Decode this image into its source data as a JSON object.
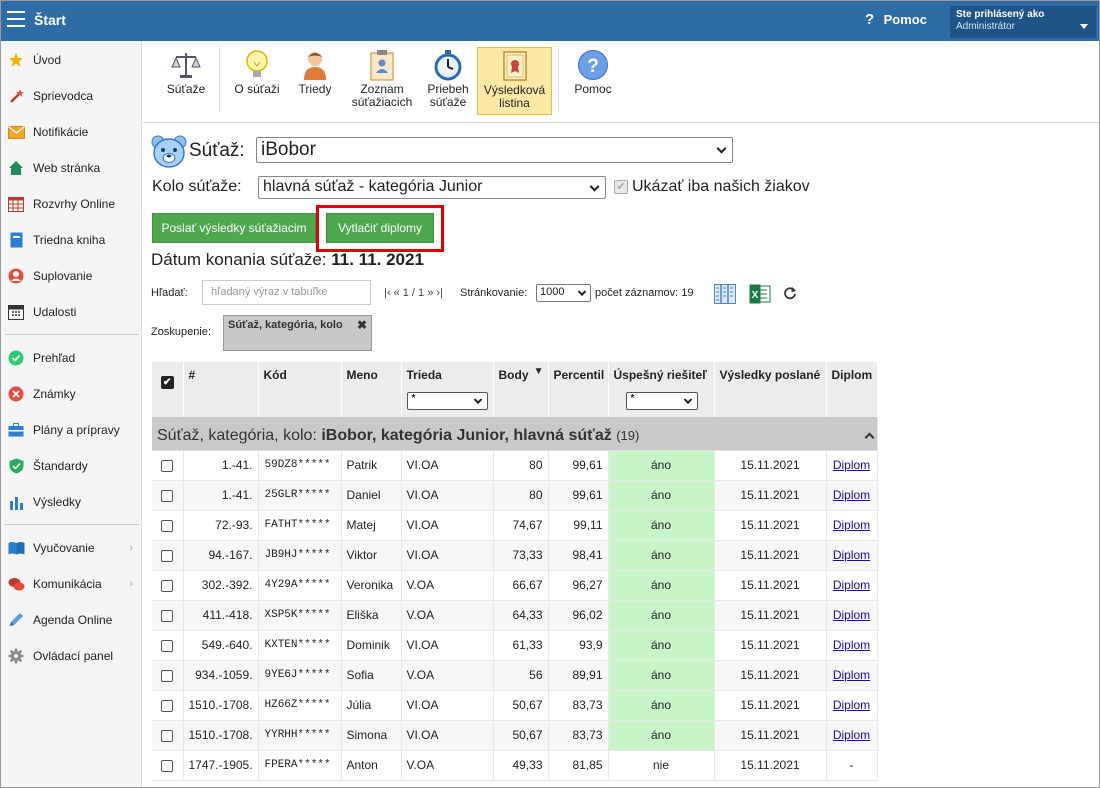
{
  "topbar": {
    "title": "Štart",
    "help": "Pomoc",
    "user_line1": "Ste prihlásený ako",
    "user_line2": "Administrátor"
  },
  "sidebar": {
    "items": [
      {
        "label": "Úvod",
        "icon": "star-icon"
      },
      {
        "label": "Sprievodca",
        "icon": "magic-wand-icon"
      },
      {
        "label": "Notifikácie",
        "icon": "envelope-icon"
      },
      {
        "label": "Web stránka",
        "icon": "home-icon"
      },
      {
        "label": "Rozvrhy Online",
        "icon": "calendar-grid-icon"
      },
      {
        "label": "Triedna kniha",
        "icon": "book-icon"
      },
      {
        "label": "Suplovanie",
        "icon": "person-icon"
      },
      {
        "label": "Udalosti",
        "icon": "calendar-icon"
      },
      {
        "label": "Prehľad",
        "icon": "check-circle-icon"
      },
      {
        "label": "Známky",
        "icon": "grade-icon"
      },
      {
        "label": "Plány a prípravy",
        "icon": "briefcase-icon"
      },
      {
        "label": "Štandardy",
        "icon": "shield-icon"
      },
      {
        "label": "Výsledky",
        "icon": "bar-chart-icon"
      },
      {
        "label": "Vyučovanie",
        "icon": "open-book-icon"
      },
      {
        "label": "Komunikácia",
        "icon": "chat-icon"
      },
      {
        "label": "Agenda Online",
        "icon": "pen-icon"
      },
      {
        "label": "Ovládací panel",
        "icon": "gear-icon"
      }
    ]
  },
  "toolbar": {
    "sutaze": "Súťaže",
    "o_sutazi": "O súťaži",
    "triedy": "Triedy",
    "zoznam_1": "Zoznam",
    "zoznam_2": "súťažiacich",
    "priebeh_1": "Priebeh",
    "priebeh_2": "súťaže",
    "vysledkova_1": "Výsledková",
    "vysledkova_2": "listina",
    "pomoc": "Pomoc"
  },
  "form": {
    "sutaz_label": "Súťaž:",
    "sutaz_value": "iBobor",
    "kolo_label": "Kolo súťaže:",
    "kolo_value": "hlavná súťaž - kategória Junior",
    "ukazat_label": "Ukázať iba našich žiakov",
    "btn_send": "Poslať výsledky súťažiacim",
    "btn_print": "Vytlačiť diplomy",
    "datum_label": "Dátum konania súťaže:",
    "datum_value": "11. 11. 2021"
  },
  "filter": {
    "hladat_label": "Hľadať:",
    "hladat_placeholder": "hľadaný výraz v tabuľke",
    "pager": "|‹ « 1 / 1 » ›|",
    "strankovanie_label": "Stránkovanie:",
    "strankovanie_value": "1000",
    "pocet": "počet záznamov: 19",
    "zoskupenie_label": "Zoskupenie:",
    "zoskupenie_chip": "Súťaž, kategória, kolo"
  },
  "table": {
    "headers": [
      "#",
      "Kód",
      "Meno",
      "Trieda",
      "Body",
      "Percentil",
      "Úspešný riešiteľ",
      "Výsledky poslané",
      "Diplom"
    ],
    "filter_value": "*",
    "group_prefix": "Súťaž, kategória, kolo:",
    "group_value": "iBobor, kategória Junior, hlavná súťaž",
    "group_count": "(19)",
    "rows": [
      {
        "rank": "1.-41.",
        "kod": "59DZ8*****",
        "meno": "Patrik",
        "trieda": "VI.OA",
        "body": "80",
        "percentil": "99,61",
        "uspesny": "áno",
        "poslane": "15.11.2021",
        "diplom": "Diplom"
      },
      {
        "rank": "1.-41.",
        "kod": "25GLR*****",
        "meno": "Daniel",
        "trieda": "VI.OA",
        "body": "80",
        "percentil": "99,61",
        "uspesny": "áno",
        "poslane": "15.11.2021",
        "diplom": "Diplom"
      },
      {
        "rank": "72.-93.",
        "kod": "FATHT*****",
        "meno": "Matej",
        "trieda": "VI.OA",
        "body": "74,67",
        "percentil": "99,11",
        "uspesny": "áno",
        "poslane": "15.11.2021",
        "diplom": "Diplom"
      },
      {
        "rank": "94.-167.",
        "kod": "JB9HJ*****",
        "meno": "Viktor",
        "trieda": "VI.OA",
        "body": "73,33",
        "percentil": "98,41",
        "uspesny": "áno",
        "poslane": "15.11.2021",
        "diplom": "Diplom"
      },
      {
        "rank": "302.-392.",
        "kod": "4Y29A*****",
        "meno": "Veronika",
        "trieda": "V.OA",
        "body": "66,67",
        "percentil": "96,27",
        "uspesny": "áno",
        "poslane": "15.11.2021",
        "diplom": "Diplom"
      },
      {
        "rank": "411.-418.",
        "kod": "XSP5K*****",
        "meno": "Eliška",
        "trieda": "V.OA",
        "body": "64,33",
        "percentil": "96,02",
        "uspesny": "áno",
        "poslane": "15.11.2021",
        "diplom": "Diplom"
      },
      {
        "rank": "549.-640.",
        "kod": "KXTEN*****",
        "meno": "Dominik",
        "trieda": "VI.OA",
        "body": "61,33",
        "percentil": "93,9",
        "uspesny": "áno",
        "poslane": "15.11.2021",
        "diplom": "Diplom"
      },
      {
        "rank": "934.-1059.",
        "kod": "9YE6J*****",
        "meno": "Sofia",
        "trieda": "V.OA",
        "body": "56",
        "percentil": "89,91",
        "uspesny": "áno",
        "poslane": "15.11.2021",
        "diplom": "Diplom"
      },
      {
        "rank": "1510.-1708.",
        "kod": "HZ66Z*****",
        "meno": "Júlia",
        "trieda": "VI.OA",
        "body": "50,67",
        "percentil": "83,73",
        "uspesny": "áno",
        "poslane": "15.11.2021",
        "diplom": "Diplom"
      },
      {
        "rank": "1510.-1708.",
        "kod": "YYRHH*****",
        "meno": "Simona",
        "trieda": "VI.OA",
        "body": "50,67",
        "percentil": "83,73",
        "uspesny": "áno",
        "poslane": "15.11.2021",
        "diplom": "Diplom"
      },
      {
        "rank": "1747.-1905.",
        "kod": "FPERA*****",
        "meno": "Anton",
        "trieda": "V.OA",
        "body": "49,33",
        "percentil": "81,85",
        "uspesny": "nie",
        "poslane": "15.11.2021",
        "diplom": "-"
      }
    ]
  },
  "colors": {
    "topbar": "#2d6ca6",
    "button_green": "#4ea84e",
    "success_cell": "#c8f5c8",
    "highlight_red": "#e10000"
  }
}
